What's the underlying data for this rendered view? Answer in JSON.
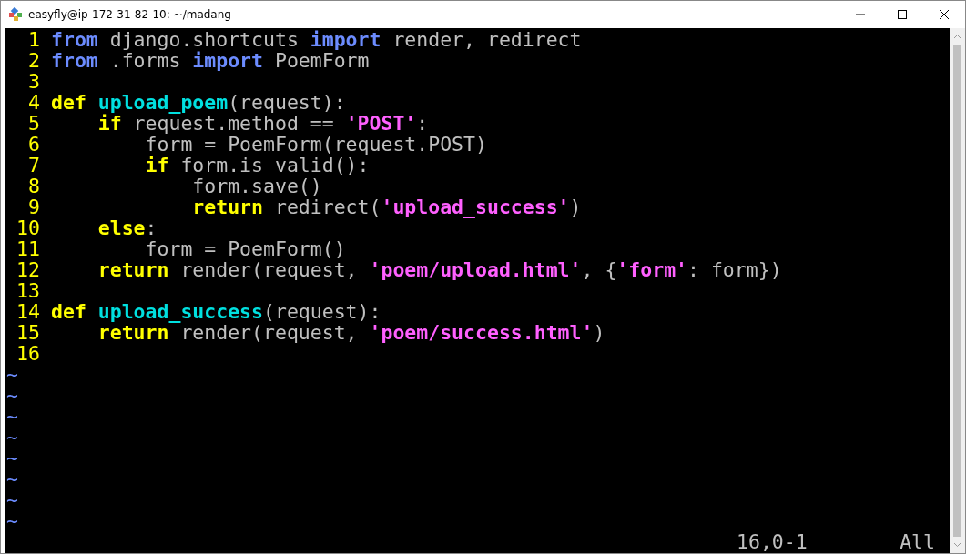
{
  "window": {
    "title": "easyfly@ip-172-31-82-10: ~/madang"
  },
  "lines": [
    {
      "number": "1",
      "tokens": [
        {
          "text": "from",
          "kind": "import"
        },
        {
          "text": " django.shortcuts ",
          "kind": "plain"
        },
        {
          "text": "import",
          "kind": "import"
        },
        {
          "text": " render, redirect",
          "kind": "plain"
        }
      ]
    },
    {
      "number": "2",
      "tokens": [
        {
          "text": "from",
          "kind": "import"
        },
        {
          "text": " .forms ",
          "kind": "plain"
        },
        {
          "text": "import",
          "kind": "import"
        },
        {
          "text": " PoemForm",
          "kind": "plain"
        }
      ]
    },
    {
      "number": "3"
    },
    {
      "number": "4",
      "tokens": [
        {
          "text": "def ",
          "kind": "keyword"
        },
        {
          "text": "upload_poem",
          "kind": "function"
        },
        {
          "text": "(request):",
          "kind": "plain"
        }
      ]
    },
    {
      "number": "5",
      "tokens": [
        {
          "text": "    if",
          "kind": "keyword"
        },
        {
          "text": " request.method == ",
          "kind": "plain"
        },
        {
          "text": "'POST'",
          "kind": "string"
        },
        {
          "text": ":",
          "kind": "plain"
        }
      ]
    },
    {
      "number": "6",
      "tokens": [
        {
          "text": "        form = PoemForm(request.POST)",
          "kind": "plain"
        }
      ]
    },
    {
      "number": "7",
      "tokens": [
        {
          "text": "        if",
          "kind": "keyword"
        },
        {
          "text": " form.is_valid():",
          "kind": "plain"
        }
      ]
    },
    {
      "number": "8",
      "tokens": [
        {
          "text": "            form.save()",
          "kind": "plain"
        }
      ]
    },
    {
      "number": "9",
      "tokens": [
        {
          "text": "            return",
          "kind": "keyword"
        },
        {
          "text": " redirect(",
          "kind": "plain"
        },
        {
          "text": "'upload_success'",
          "kind": "string"
        },
        {
          "text": ")",
          "kind": "plain"
        }
      ]
    },
    {
      "number": "10",
      "tokens": [
        {
          "text": "    else",
          "kind": "keyword"
        },
        {
          "text": ":",
          "kind": "plain"
        }
      ]
    },
    {
      "number": "11",
      "tokens": [
        {
          "text": "        form = PoemForm()",
          "kind": "plain"
        }
      ]
    },
    {
      "number": "12",
      "tokens": [
        {
          "text": "    return",
          "kind": "keyword"
        },
        {
          "text": " render(request, ",
          "kind": "plain"
        },
        {
          "text": "'poem/upload.html'",
          "kind": "string"
        },
        {
          "text": ", {",
          "kind": "plain"
        },
        {
          "text": "'form'",
          "kind": "string"
        },
        {
          "text": ": form})",
          "kind": "plain"
        }
      ]
    },
    {
      "number": "13"
    },
    {
      "number": "14",
      "tokens": [
        {
          "text": "def ",
          "kind": "keyword"
        },
        {
          "text": "upload_success",
          "kind": "function"
        },
        {
          "text": "(request):",
          "kind": "plain"
        }
      ]
    },
    {
      "number": "15",
      "tokens": [
        {
          "text": "    return",
          "kind": "keyword"
        },
        {
          "text": " render(request, ",
          "kind": "plain"
        },
        {
          "text": "'poem/success.html'",
          "kind": "string"
        },
        {
          "text": ")",
          "kind": "plain"
        }
      ]
    },
    {
      "number": "16"
    }
  ],
  "filler_lines": [
    "~",
    "~",
    "~",
    "~",
    "~",
    "~",
    "~",
    "~"
  ],
  "status_bar": {
    "position": "16,0-1",
    "scroll": "All"
  }
}
